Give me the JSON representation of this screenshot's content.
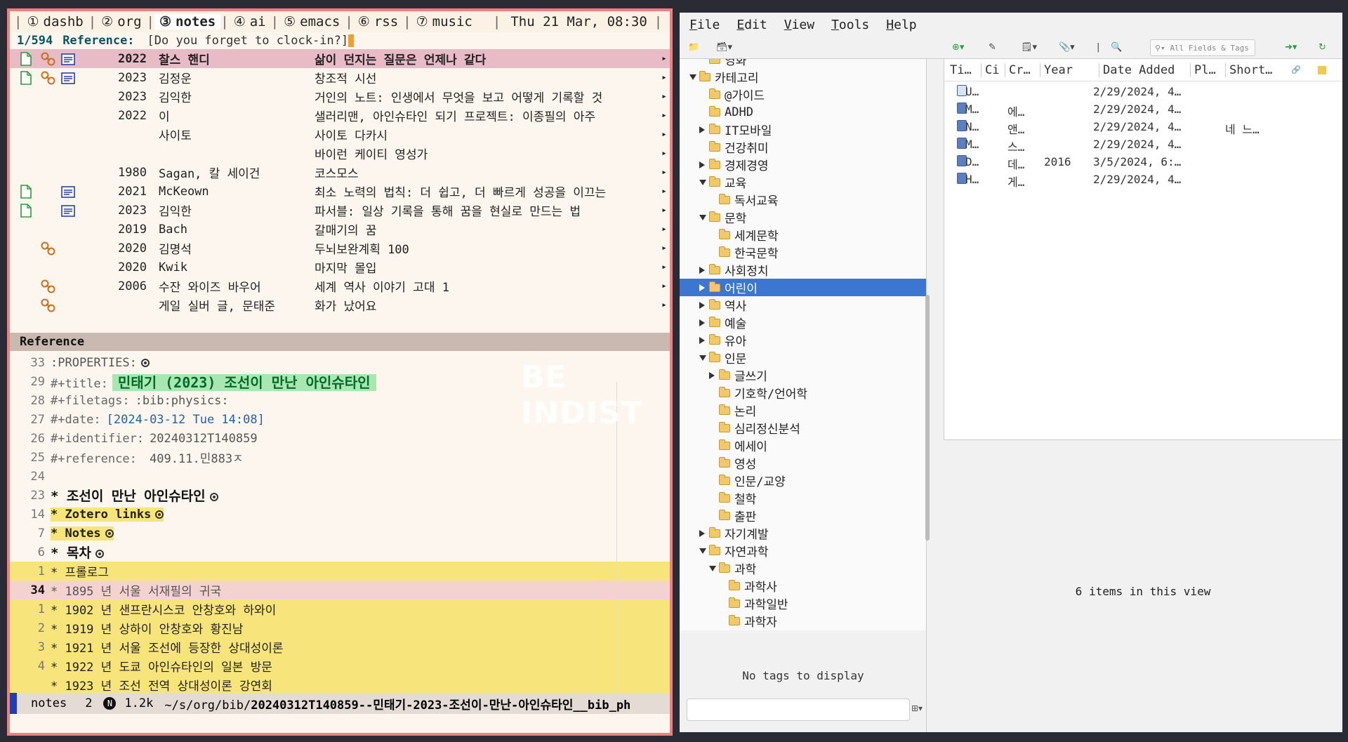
{
  "topbar": {
    "workspaces": [
      {
        "num": "①",
        "name": "dashb",
        "active": false
      },
      {
        "num": "②",
        "name": "org",
        "active": false
      },
      {
        "num": "③",
        "name": "notes",
        "active": true
      },
      {
        "num": "④",
        "name": "ai",
        "active": false
      },
      {
        "num": "⑤",
        "name": "emacs",
        "active": false
      },
      {
        "num": "⑥",
        "name": "rss",
        "active": false
      },
      {
        "num": "⑦",
        "name": "music",
        "active": false
      }
    ],
    "clock": "Thu 21 Mar, 08:30"
  },
  "minibuffer": {
    "count": "1/594",
    "label": "Reference:",
    "prompt": "[Do you forget to clock-in?]"
  },
  "references": [
    {
      "file": true,
      "link": true,
      "note": true,
      "year": "2022",
      "author": "찰스 핸디",
      "title": "삶이 던지는 질문은 언제나 같다",
      "selected": true
    },
    {
      "file": true,
      "link": true,
      "note": true,
      "year": "2023",
      "author": "김정운",
      "title": "창조적 시선"
    },
    {
      "file": false,
      "link": false,
      "note": false,
      "year": "2023",
      "author": "김익한",
      "title": "거인의 노트: 인생에서 무엇을 보고 어떻게 기록할 것"
    },
    {
      "file": false,
      "link": false,
      "note": false,
      "year": "2022",
      "author": "이",
      "title": "샐러리맨, 아인슈타인 되기 프로젝트: 이종필의 아주"
    },
    {
      "file": false,
      "link": false,
      "note": false,
      "year": "",
      "author": "사이토",
      "title": "사이토 다카시"
    },
    {
      "file": false,
      "link": false,
      "note": false,
      "year": "",
      "author": "",
      "title": "바이런 케이티 영성가"
    },
    {
      "file": false,
      "link": false,
      "note": false,
      "year": "1980",
      "author": "Sagan, 칼 세이건",
      "title": "코스모스"
    },
    {
      "file": true,
      "link": false,
      "note": true,
      "year": "2021",
      "author": "McKeown",
      "title": "최소 노력의 법칙: 더 쉽고, 더 빠르게 성공을 이끄는"
    },
    {
      "file": true,
      "link": false,
      "note": true,
      "year": "2023",
      "author": "김익한",
      "title": "파서블: 일상 기록을 통해 꿈을 현실로 만드는 법"
    },
    {
      "file": false,
      "link": false,
      "note": false,
      "year": "2019",
      "author": "Bach",
      "title": "갈매기의 꿈"
    },
    {
      "file": false,
      "link": true,
      "note": false,
      "year": "2020",
      "author": "김명석",
      "title": "두뇌보완계획 100"
    },
    {
      "file": false,
      "link": false,
      "note": false,
      "year": "2020",
      "author": "Kwik",
      "title": "마지막 몰입"
    },
    {
      "file": false,
      "link": true,
      "note": false,
      "year": "2006",
      "author": "수잔 와이즈 바우어",
      "title": "세계 역사 이야기 고대 1"
    },
    {
      "file": false,
      "link": true,
      "note": false,
      "year": "",
      "author": "게일 실버 글, 문태준",
      "title": "화가 났어요"
    }
  ],
  "ref_header": "Reference",
  "watermark": "BE INDIST",
  "editor": {
    "lines": [
      {
        "num": "33",
        "kind": "props",
        "text": ":PROPERTIES:"
      },
      {
        "num": "29",
        "kind": "title",
        "key": "#+title:",
        "value": "민태기 (2023) 조선이 만난 아인슈타인"
      },
      {
        "num": "28",
        "kind": "kv",
        "key": "#+filetags:",
        "value": ":bib:physics:"
      },
      {
        "num": "27",
        "kind": "date",
        "key": "#+date:",
        "value": "[2024-03-12 Tue 14:08]"
      },
      {
        "num": "26",
        "kind": "kv",
        "key": "#+identifier:",
        "value": "20240312T140859"
      },
      {
        "num": "25",
        "kind": "kv",
        "key": "#+reference:",
        "value": " 409.11.민883ㅈ"
      },
      {
        "num": "24",
        "kind": "blank",
        "text": ""
      },
      {
        "num": "23",
        "kind": "h1",
        "text": "* 조선이 만난 아인슈타인",
        "dot": true
      },
      {
        "num": "14",
        "kind": "h2y",
        "text": " * Zotero links",
        "dot": true
      },
      {
        "num": "7",
        "kind": "h2y",
        "text": " * Notes",
        "dot": true
      },
      {
        "num": "6",
        "kind": "h1",
        "text": "* 목차",
        "dot": true
      },
      {
        "num": "1",
        "kind": "yline",
        "text": " * 프롤로그"
      },
      {
        "num": "34",
        "kind": "cur",
        "text": " * 1895 년 서울 서재필의 귀국"
      },
      {
        "num": "1",
        "kind": "yline",
        "text": " * 1902 년 샌프란시스코 안창호와 하와이"
      },
      {
        "num": "2",
        "kind": "yline",
        "text": " * 1919 년 상하이 안창호와 황진남"
      },
      {
        "num": "3",
        "kind": "yline",
        "text": " * 1921 년 서울 조선에 등장한 상대성이론"
      },
      {
        "num": "4",
        "kind": "yline",
        "text": " * 1922 년 도쿄 아인슈타인의 일본 방문"
      },
      {
        "num": "",
        "kind": "yline",
        "text": " * 1923 년 조선 전역 상대성이론 강연회"
      }
    ]
  },
  "modeline": {
    "buffer": "notes",
    "num": "2",
    "badge": "N",
    "size": "1.2k",
    "path_prefix": "~/s/org/bib/",
    "path_file": "20240312T140859--민태기-2023-조선이-만난-아인슈타인__bib_ph"
  },
  "zotero": {
    "menu": [
      "File",
      "Edit",
      "View",
      "Tools",
      "Help"
    ],
    "search_placeholder": "All Fields & Tags",
    "collections": [
      {
        "label": "영화",
        "depth": 1,
        "twisty": "none"
      },
      {
        "label": "카테고리",
        "depth": 0,
        "twisty": "open"
      },
      {
        "label": "@가이드",
        "depth": 1,
        "twisty": "none"
      },
      {
        "label": "ADHD",
        "depth": 1,
        "twisty": "none"
      },
      {
        "label": "IT모바일",
        "depth": 1,
        "twisty": "closed"
      },
      {
        "label": "건강취미",
        "depth": 1,
        "twisty": "none"
      },
      {
        "label": "경제경영",
        "depth": 1,
        "twisty": "closed"
      },
      {
        "label": "교육",
        "depth": 1,
        "twisty": "open"
      },
      {
        "label": "독서교육",
        "depth": 2,
        "twisty": "none"
      },
      {
        "label": "문학",
        "depth": 1,
        "twisty": "open"
      },
      {
        "label": "세계문학",
        "depth": 2,
        "twisty": "none"
      },
      {
        "label": "한국문학",
        "depth": 2,
        "twisty": "none"
      },
      {
        "label": "사회정치",
        "depth": 1,
        "twisty": "closed"
      },
      {
        "label": "어린이",
        "depth": 1,
        "twisty": "closed",
        "selected": true
      },
      {
        "label": "역사",
        "depth": 1,
        "twisty": "closed"
      },
      {
        "label": "예술",
        "depth": 1,
        "twisty": "closed"
      },
      {
        "label": "유아",
        "depth": 1,
        "twisty": "closed"
      },
      {
        "label": "인문",
        "depth": 1,
        "twisty": "open"
      },
      {
        "label": "글쓰기",
        "depth": 2,
        "twisty": "closed"
      },
      {
        "label": "기호학/언어학",
        "depth": 2,
        "twisty": "none"
      },
      {
        "label": "논리",
        "depth": 2,
        "twisty": "none"
      },
      {
        "label": "심리정신분석",
        "depth": 2,
        "twisty": "none"
      },
      {
        "label": "에세이",
        "depth": 2,
        "twisty": "none"
      },
      {
        "label": "영성",
        "depth": 2,
        "twisty": "none"
      },
      {
        "label": "인문/교양",
        "depth": 2,
        "twisty": "none"
      },
      {
        "label": "철학",
        "depth": 2,
        "twisty": "none"
      },
      {
        "label": "출판",
        "depth": 2,
        "twisty": "none"
      },
      {
        "label": "자기계발",
        "depth": 1,
        "twisty": "closed"
      },
      {
        "label": "자연과학",
        "depth": 1,
        "twisty": "open"
      },
      {
        "label": "과학",
        "depth": 2,
        "twisty": "open"
      },
      {
        "label": "과학사",
        "depth": 3,
        "twisty": "none"
      },
      {
        "label": "과학일반",
        "depth": 3,
        "twisty": "none"
      },
      {
        "label": "과학자",
        "depth": 3,
        "twisty": "none"
      }
    ],
    "tags_message": "No tags to display",
    "columns": [
      "Ti…",
      "Ci",
      "Cr…",
      "Year",
      "Date Added",
      "Pl…",
      "Short…"
    ],
    "items": [
      {
        "type": "doc",
        "title": "U…",
        "creator": "",
        "year": "",
        "date": "2/29/2024, 4…",
        "short": ""
      },
      {
        "type": "book",
        "title": "M…",
        "creator": "에…",
        "year": "",
        "date": "2/29/2024, 4…",
        "short": ""
      },
      {
        "type": "book",
        "title": "N…",
        "creator": "앤…",
        "year": "",
        "date": "2/29/2024, 4…",
        "short": "네 느…"
      },
      {
        "type": "book",
        "title": "M…",
        "creator": "스…",
        "year": "",
        "date": "2/29/2024, 4…",
        "short": ""
      },
      {
        "type": "book",
        "title": "D…",
        "creator": "데…",
        "year": "2016",
        "date": "3/5/2024, 6:…",
        "short": ""
      },
      {
        "type": "book",
        "title": "H…",
        "creator": "게…",
        "year": "",
        "date": "2/29/2024, 4…",
        "short": ""
      }
    ],
    "items_count_message": "6 items in this view"
  }
}
